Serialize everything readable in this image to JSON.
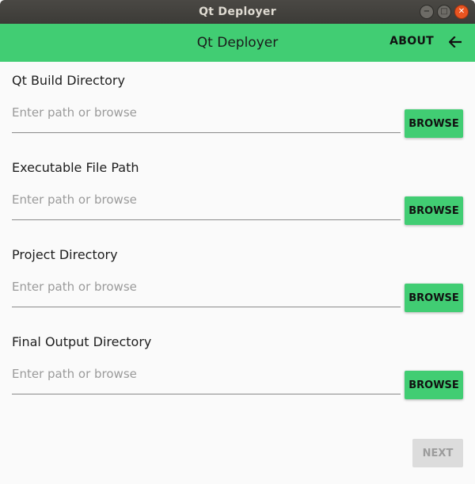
{
  "window": {
    "title": "Qt Deployer",
    "controls": {
      "minimize": "−",
      "maximize": "□",
      "close": "✕"
    }
  },
  "appbar": {
    "title": "Qt Deployer",
    "about_label": "ABOUT",
    "back_icon": "arrow-left-icon",
    "color": "#41cd73"
  },
  "fields": [
    {
      "label": "Qt Build Directory",
      "value": "",
      "placeholder": "Enter path or browse",
      "button": "BROWSE"
    },
    {
      "label": "Executable File Path",
      "value": "",
      "placeholder": "Enter path or browse",
      "button": "BROWSE"
    },
    {
      "label": "Project Directory",
      "value": "",
      "placeholder": "Enter path or browse",
      "button": "BROWSE"
    },
    {
      "label": "Final Output Directory",
      "value": "",
      "placeholder": "Enter path or browse",
      "button": "BROWSE"
    }
  ],
  "footer": {
    "next_label": "NEXT",
    "next_enabled": false
  }
}
